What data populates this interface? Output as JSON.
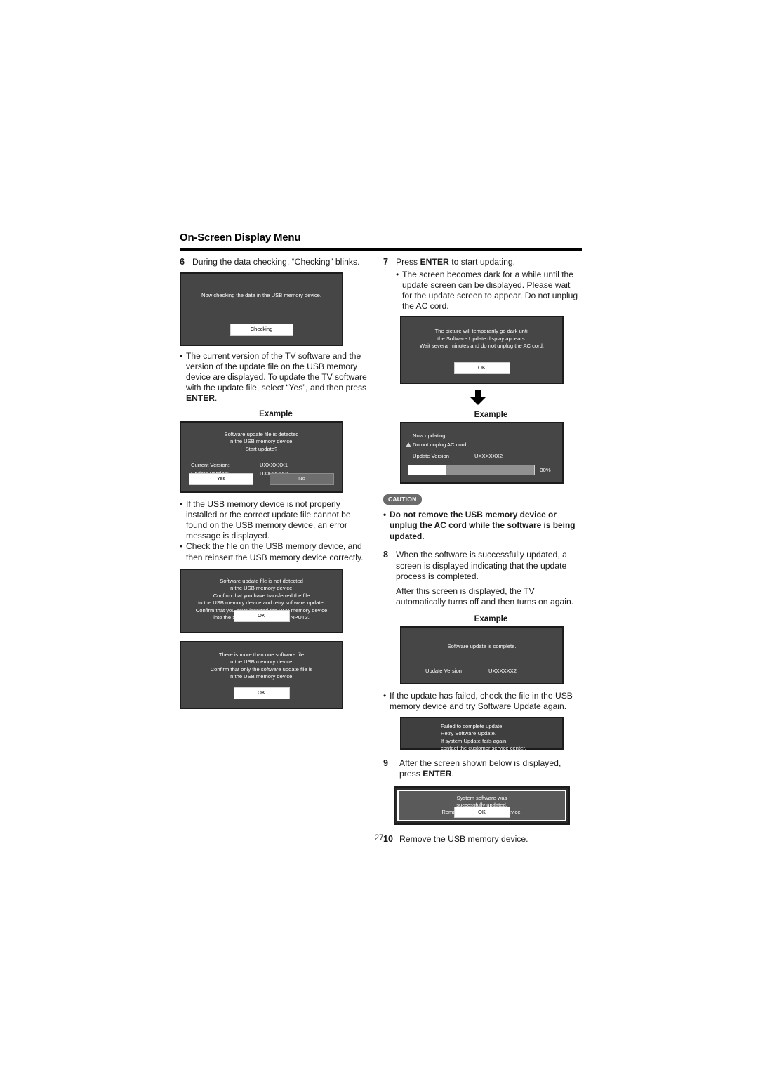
{
  "document": {
    "header_title": "On-Screen Display Menu",
    "page_number": "27"
  },
  "left_column": {
    "step6": {
      "number": "6",
      "text": "During the data checking, “Checking” blinks."
    },
    "dialog_checking": {
      "message": "Now checking the data in the USB memory device.",
      "button": "Checking"
    },
    "bullet_versions": {
      "dot": "•",
      "text_part1": "The current version of the TV software and the version of the update file on the USB memory device are displayed. To update the TV software with the update file, select “Yes”, and then press ",
      "text_bold": "ENTER",
      "text_part2": "."
    },
    "example_label_1": "Example",
    "dialog_version": {
      "message": "Software update file is detected\nin the USB memory device.\nStart update?",
      "current_version_label": "Current Version:",
      "current_version_value": "UXXXXXX1",
      "update_version_label": "Update Version:",
      "update_version_value": "UXXXXXX2",
      "yes_button": "Yes",
      "no_button": "No"
    },
    "bullet_error": {
      "dot": "•",
      "text": "If the USB memory device is not properly installed or the correct update file cannot be found on the USB memory device, an error message is displayed."
    },
    "bullet_check": {
      "dot": "•",
      "text": "Check the file on the USB memory device, and then reinsert the USB memory device correctly."
    },
    "dialog_not_detected": {
      "message": "Software update file is not detected\nin the USB memory device.\nConfirm that you have transferred the file\nto the USB memory device and retry software update.\nConfirm that you have inserted the USB memory device\ninto the SERVICE port near the INPUT3.",
      "button": "OK"
    },
    "dialog_more_than_one": {
      "message": "There is more than one software file\nin the USB memory device.\nConfirm that only the software update file is\nin the USB memory device.",
      "button": "OK"
    }
  },
  "right_column": {
    "step7": {
      "number": "7",
      "text_part1": "Press ",
      "text_bold": "ENTER",
      "text_part2": " to start updating."
    },
    "step7_bullet": {
      "dot": "•",
      "text": "The screen becomes dark for a while until the update screen can be displayed. Please wait for the update screen to appear. Do not unplug the AC cord."
    },
    "dialog_go_dark": {
      "message": "The picture will temporarily go dark until\nthe Software Update display appears.\nWait several minutes and do not unplug the AC cord.",
      "button": "OK"
    },
    "example_label_2": "Example",
    "dialog_updating": {
      "line1": "Now updating",
      "line2": "Do not unplug AC cord.",
      "warning_icon": "warning-triangle-icon",
      "update_version_label": "Update Version",
      "update_version_value": "UXXXXXX2",
      "progress_percent": "30%",
      "progress_value": 30
    },
    "caution": {
      "badge": "CAUTION",
      "dot": "•",
      "text": "Do not remove the USB memory device or unplug the AC cord while the software is being updated."
    },
    "step8": {
      "number": "8",
      "text": "When the software is successfully updated, a screen is displayed indicating that the update process is completed.",
      "text_cont": "After this screen is displayed, the TV automatically turns off and then turns on again."
    },
    "example_label_3": "Example",
    "dialog_complete": {
      "message": "Software update is complete.",
      "update_version_label": "Update Version",
      "update_version_value": "UXXXXXX2"
    },
    "bullet_failed": {
      "dot": "•",
      "text": "If the update has failed, check the file in the USB memory device and try Software Update again."
    },
    "dialog_failed": {
      "message": "Failed to complete update.\nRetry Software Update.\nIf system Update fails again,\ncontact the customer service center."
    },
    "step9": {
      "number": "9",
      "text_part1": "After the screen shown below is displayed, press ",
      "text_bold": "ENTER",
      "text_part2": "."
    },
    "dialog_system_software": {
      "message": "System software was\nsuccessfully updated.\nRemove the USB memory device.",
      "button": "OK"
    },
    "step10": {
      "number": "10",
      "text": "Remove the USB memory device."
    }
  },
  "colors": {
    "dialog_bg": "#464646",
    "dialog_border": "#1c1c1c",
    "button_selected": "#ffffff",
    "button_dim": "#6e6e6e",
    "caution_badge_bg": "#6b6b6b",
    "progress_track": "#909090",
    "progress_fill": "#ffffff"
  }
}
